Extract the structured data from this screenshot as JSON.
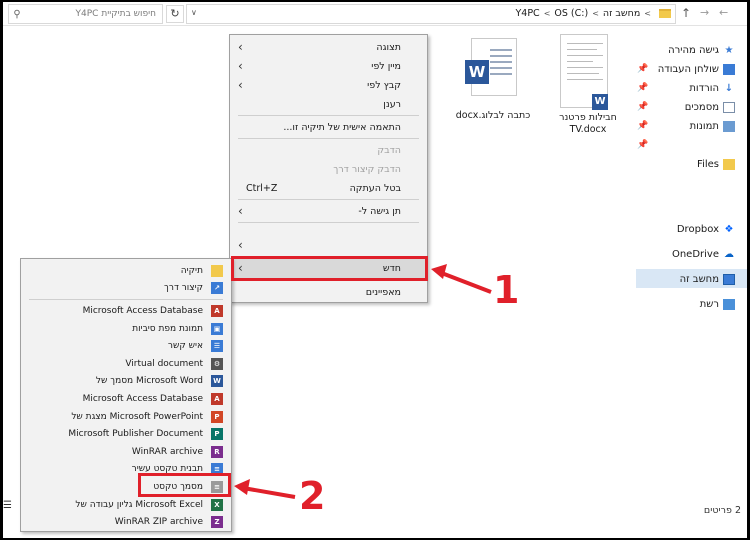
{
  "search": {
    "placeholder": "חיפוש בתיקיית Y4PC",
    "icon": "search-icon"
  },
  "address": {
    "crumbs": [
      "מחשב זה",
      "OS (C:)",
      "Y4PC"
    ],
    "refresh_symbol": "↻"
  },
  "nav": {
    "quick_access": "גישה מהירה",
    "desktop": "שולחן העבודה",
    "downloads": "הורדות",
    "documents": "מסמכים",
    "pictures": "תמונות",
    "files": "Files",
    "dropbox": "Dropbox",
    "onedrive": "OneDrive",
    "this_pc": "מחשב זה",
    "network": "רשת"
  },
  "files": [
    {
      "name": "כתבה לבלוג.docx",
      "badge": "W"
    },
    {
      "name": "חבילות פרטנר TV.docx",
      "badge": "W"
    }
  ],
  "context_menu": {
    "view": "תצוגה",
    "sort_by": "מיין לפי",
    "group_by": "קבץ לפי",
    "refresh": "רענן",
    "customize": "התאמה אישית של תיקיה זו...",
    "paste": "הדבק",
    "paste_shortcut": "הדבק קיצור דרך",
    "undo_copy": "בטל העתקה",
    "undo_shortcut": "Ctrl+Z",
    "give_access": "תן גישה ל-",
    "new": "חדש",
    "properties": "מאפיינים"
  },
  "submenu": {
    "folder": "תיקיה",
    "shortcut": "קיצור דרך",
    "items": [
      {
        "label": "Microsoft Access Database",
        "icon": "access-icon",
        "color": "#c0392b",
        "glyph": "A"
      },
      {
        "label": "תמונת מפת סיביות",
        "icon": "bitmap-icon",
        "color": "#3a7bd5",
        "glyph": "▣"
      },
      {
        "label": "איש קשר",
        "icon": "contact-icon",
        "color": "#3a7bd5",
        "glyph": "☰"
      },
      {
        "label": "Virtual document",
        "icon": "virtual-document-icon",
        "color": "#555555",
        "glyph": "⚙"
      },
      {
        "label": "מסמך של Microsoft Word",
        "icon": "word-icon",
        "color": "#2b579a",
        "glyph": "W"
      },
      {
        "label": "Microsoft Access Database",
        "icon": "access-icon",
        "color": "#c0392b",
        "glyph": "A"
      },
      {
        "label": "מצגת של Microsoft PowerPoint",
        "icon": "powerpoint-icon",
        "color": "#d24726",
        "glyph": "P"
      },
      {
        "label": "Microsoft Publisher Document",
        "icon": "publisher-icon",
        "color": "#077568",
        "glyph": "P"
      },
      {
        "label": "WinRAR archive",
        "icon": "winrar-icon",
        "color": "#7b2d8e",
        "glyph": "R"
      },
      {
        "label": "תבנית טקסט עשיר",
        "icon": "rich-text-icon",
        "color": "#3a7bd5",
        "glyph": "≡"
      },
      {
        "label": "מסמך טקסט",
        "icon": "text-document-icon",
        "color": "#9a9a9a",
        "glyph": "≡"
      },
      {
        "label": "גליון עבודה של Microsoft Excel",
        "icon": "excel-icon",
        "color": "#217346",
        "glyph": "X"
      },
      {
        "label": "WinRAR ZIP archive",
        "icon": "winrar-zip-icon",
        "color": "#7b2d8e",
        "glyph": "Z"
      }
    ]
  },
  "callouts": {
    "one": "1",
    "two": "2"
  },
  "status": {
    "count": "2 פריטים"
  },
  "colors": {
    "highlight_red": "#e0202a",
    "word_blue": "#2b579a",
    "selection_blue": "#d9e7f5"
  }
}
